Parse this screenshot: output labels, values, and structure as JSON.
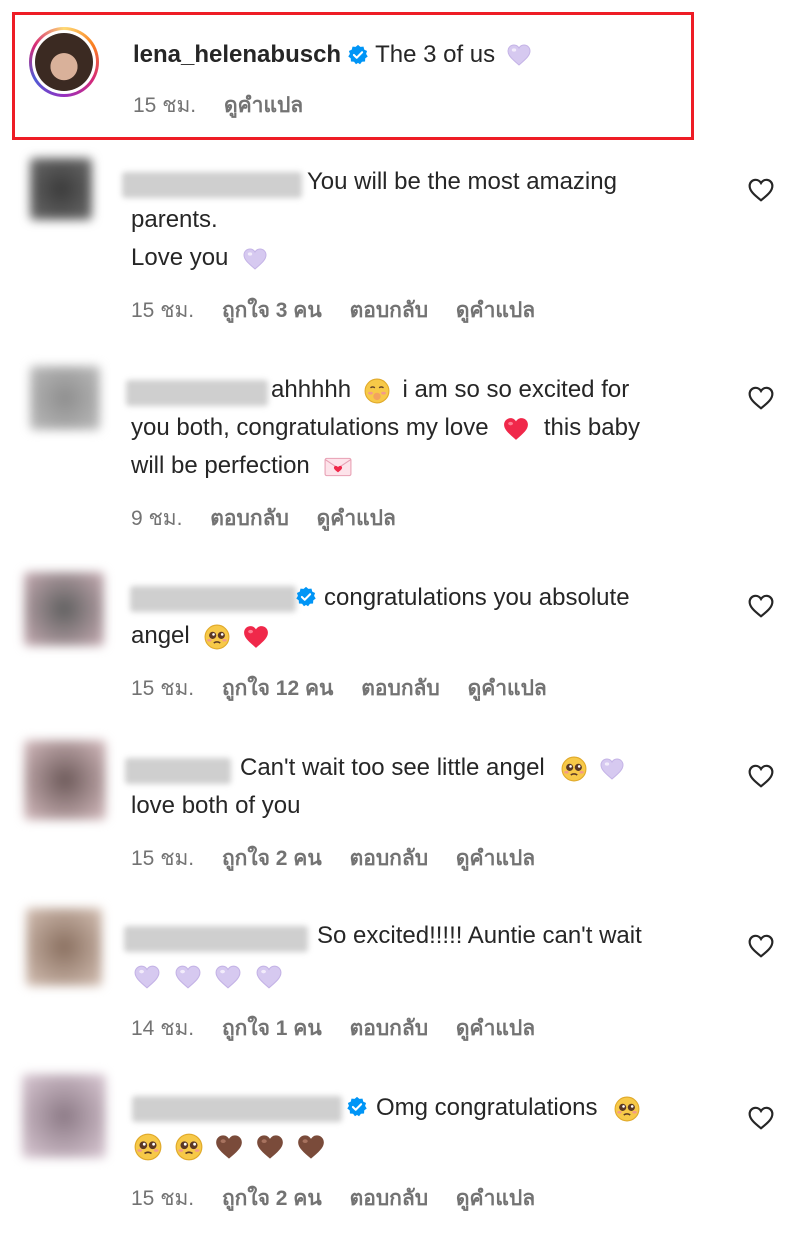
{
  "caption": {
    "username": "lena_helenabusch",
    "text": "The 3 of us",
    "time": "15 ชม.",
    "translate": "ดูคำแปล"
  },
  "comments": [
    {
      "text_lines": [
        "You will be the most amazing",
        "parents.",
        "Love you"
      ],
      "time": "15 ชม.",
      "likes": "ถูกใจ 3 คน",
      "reply": "ตอบกลับ",
      "translate": "ดูคำแปล"
    },
    {
      "text_lines": [
        "ahhhhh",
        "i am so so excited for",
        "you both, congratulations my love",
        "this baby",
        "will be perfection"
      ],
      "time": "9 ชม.",
      "reply": "ตอบกลับ",
      "translate": "ดูคำแปล"
    },
    {
      "text_lines": [
        "congratulations you absolute",
        "angel"
      ],
      "time": "15 ชม.",
      "likes": "ถูกใจ 12 คน",
      "reply": "ตอบกลับ",
      "translate": "ดูคำแปล"
    },
    {
      "text_lines": [
        "Can't wait too see little angel",
        "love both of you"
      ],
      "time": "15 ชม.",
      "likes": "ถูกใจ 2 คน",
      "reply": "ตอบกลับ",
      "translate": "ดูคำแปล"
    },
    {
      "text_lines": [
        "So excited!!!!! Auntie can't wait"
      ],
      "time": "14 ชม.",
      "likes": "ถูกใจ 1 คน",
      "reply": "ตอบกลับ",
      "translate": "ดูคำแปล"
    },
    {
      "text_lines": [
        "Omg congratulations"
      ],
      "time": "15 ชม.",
      "likes": "ถูกใจ 2 คน",
      "reply": "ตอบกลับ",
      "translate": "ดูคำแปล"
    }
  ],
  "icons": {
    "like": "heart-outline-icon",
    "verified": "verified-badge-icon",
    "lavender_heart": "light-purple-heart-emoji",
    "red_heart": "red-heart-emoji",
    "brown_heart": "brown-heart-emoji",
    "pleading": "pleading-face-emoji",
    "shy": "shy-face-emoji",
    "love_letter": "love-letter-emoji"
  },
  "colors": {
    "highlight_border": "#ee1c25",
    "verified": "#0095f6",
    "meta_text": "#737373",
    "lavender_heart": "#d6c9f0",
    "red_heart": "#f0284a",
    "brown_heart": "#7a4b3a"
  }
}
